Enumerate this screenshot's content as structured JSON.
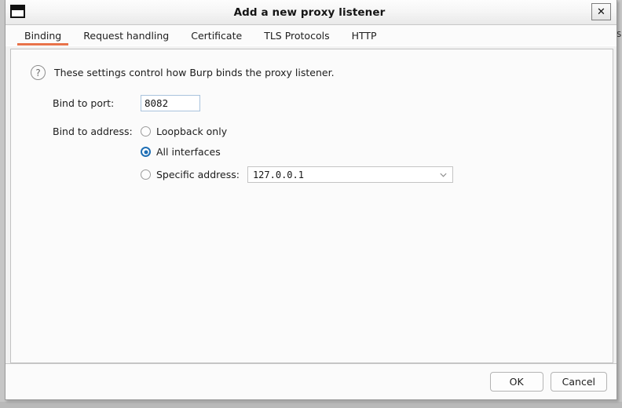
{
  "window": {
    "icon": "window-icon",
    "title": "Add a new proxy listener",
    "close_label": "✕"
  },
  "tabs": [
    {
      "label": "Binding",
      "active": true
    },
    {
      "label": "Request handling",
      "active": false
    },
    {
      "label": "Certificate",
      "active": false
    },
    {
      "label": "TLS Protocols",
      "active": false
    },
    {
      "label": "HTTP",
      "active": false
    }
  ],
  "info": {
    "icon": "question-mark-icon",
    "glyph": "?",
    "text": "These settings control how Burp binds the proxy listener."
  },
  "form": {
    "port": {
      "label": "Bind to port:",
      "value": "8082"
    },
    "address": {
      "label": "Bind to address:",
      "options": [
        {
          "label": "Loopback only",
          "selected": false
        },
        {
          "label": "All interfaces",
          "selected": true
        },
        {
          "label": "Specific address:",
          "selected": false
        }
      ],
      "specific_select": {
        "value": "127.0.0.1",
        "icon": "chevron-down-icon"
      }
    }
  },
  "footer": {
    "ok_label": "OK",
    "cancel_label": "Cancel"
  },
  "background": {
    "edge_text": "s"
  },
  "colors": {
    "accent": "#e8734a",
    "radio_selected": "#1f6fb5",
    "dialog_bg": "#f2f2f2",
    "panel_bg": "#fbfbfb",
    "desktop": "#b9b9b9"
  }
}
